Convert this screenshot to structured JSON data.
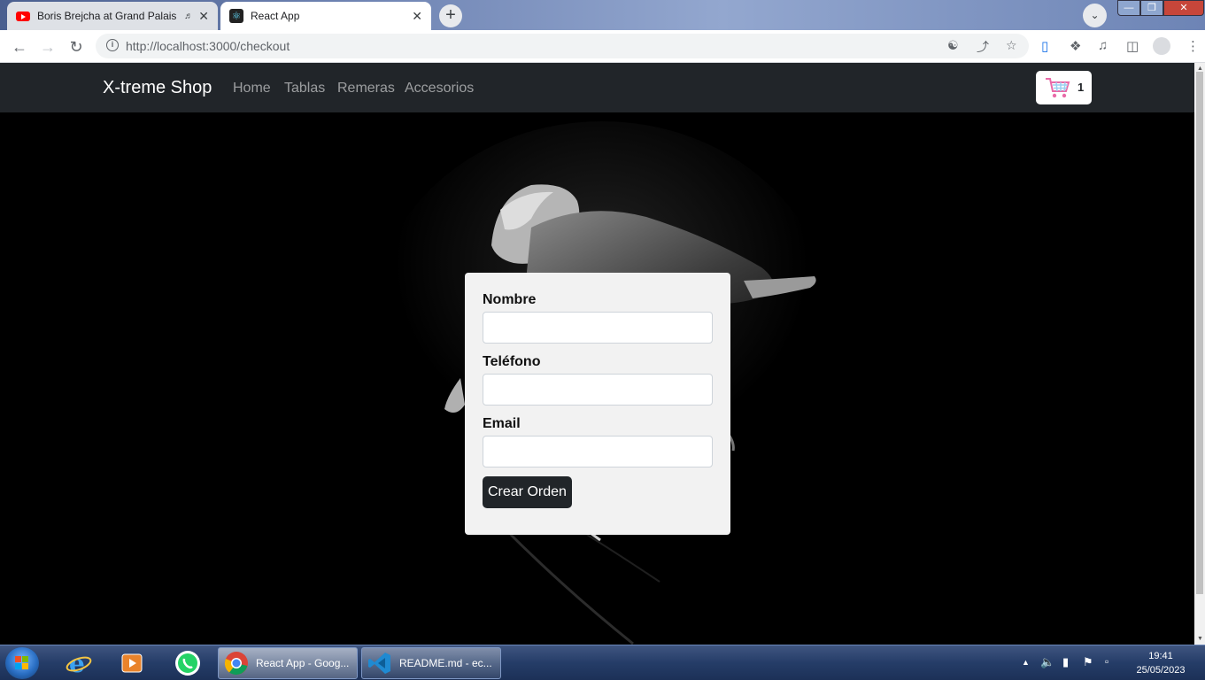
{
  "browser": {
    "tabs": [
      {
        "title": "Boris Brejcha at Grand Palais",
        "icon": "youtube-icon",
        "audio": true
      },
      {
        "title": "React App",
        "icon": "react-icon"
      }
    ],
    "url": "http://localhost:3000/checkout"
  },
  "site": {
    "brand": "X-treme Shop",
    "nav": [
      "Home",
      "Tablas",
      "Remeras",
      "Accesorios"
    ],
    "cart_count": "1"
  },
  "form": {
    "fields": [
      {
        "label": "Nombre",
        "value": ""
      },
      {
        "label": "Teléfono",
        "value": ""
      },
      {
        "label": "Email",
        "value": ""
      }
    ],
    "submit_label": "Crear Orden"
  },
  "taskbar": {
    "pinned": [
      "internet-explorer-icon",
      "media-player-icon",
      "whatsapp-icon"
    ],
    "windows": [
      {
        "label": "React App - Goog...",
        "icon": "chrome-icon",
        "active": true
      },
      {
        "label": "README.md - ec...",
        "icon": "vscode-icon",
        "active": false
      }
    ],
    "time": "19:41",
    "date": "25/05/2023"
  },
  "colors": {
    "navbar_bg": "#212529",
    "button_bg": "#212529",
    "form_bg": "#f2f2f2",
    "cart_icon": "#e86aa8"
  }
}
